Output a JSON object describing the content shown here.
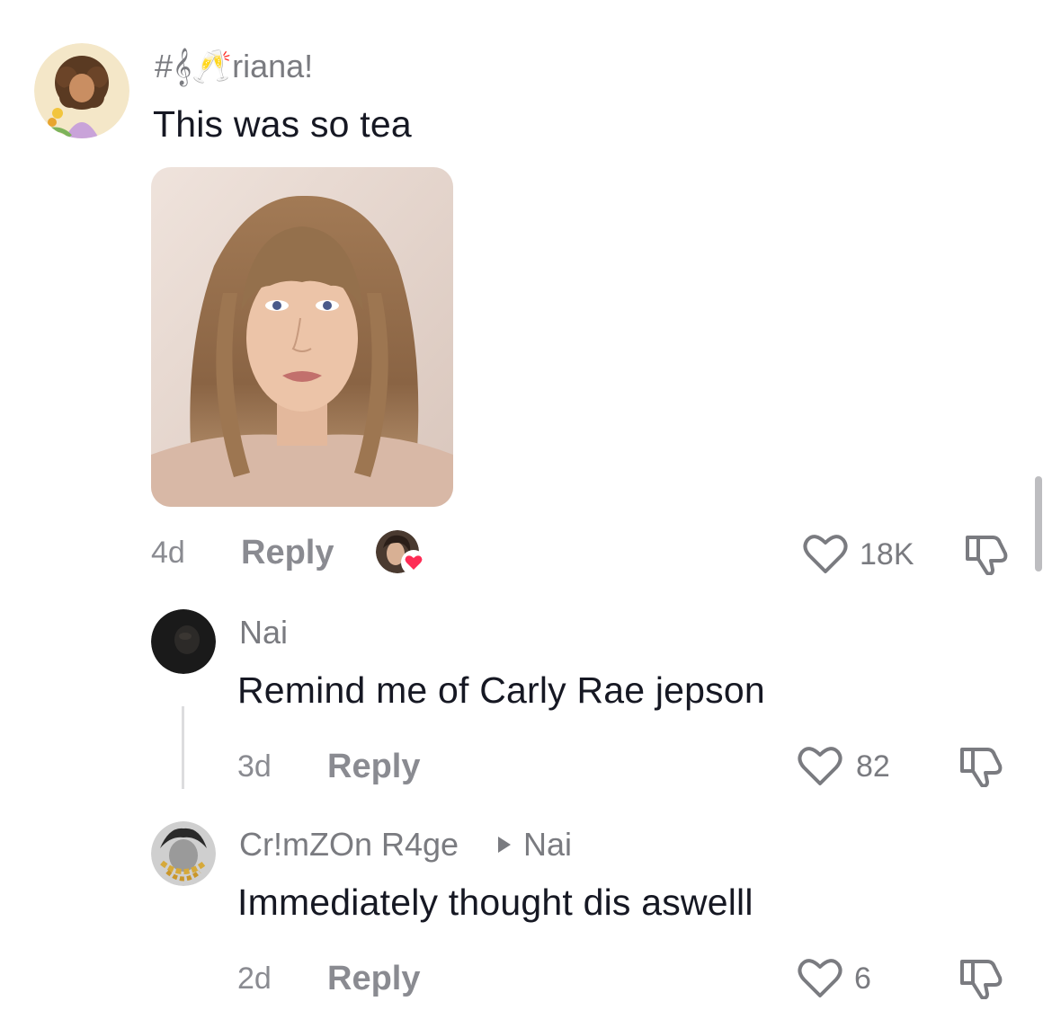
{
  "comments": [
    {
      "username": "#𝄞🥂riana!",
      "text": "This was so tea",
      "time": "4d",
      "reply_label": "Reply",
      "likes": "18K",
      "has_image": true,
      "creator_liked": true
    },
    {
      "username": "Nai",
      "text": "Remind me of Carly Rae jepson",
      "time": "3d",
      "reply_label": "Reply",
      "likes": "82"
    },
    {
      "username": "Cr!mZOn R4ge",
      "reply_to": "Nai",
      "text": "Immediately thought dis aswelll",
      "time": "2d",
      "reply_label": "Reply",
      "likes": "6"
    }
  ],
  "icons": {
    "like": "heart-outline-icon",
    "dislike": "thumbs-down-icon",
    "reply_arrow": "play-triangle-icon",
    "creator_heart": "heart-filled-icon"
  },
  "colors": {
    "text_primary": "#161823",
    "text_secondary": "#8a8b91",
    "heart_red": "#fe2c55",
    "thread_line": "#dcdcde"
  }
}
